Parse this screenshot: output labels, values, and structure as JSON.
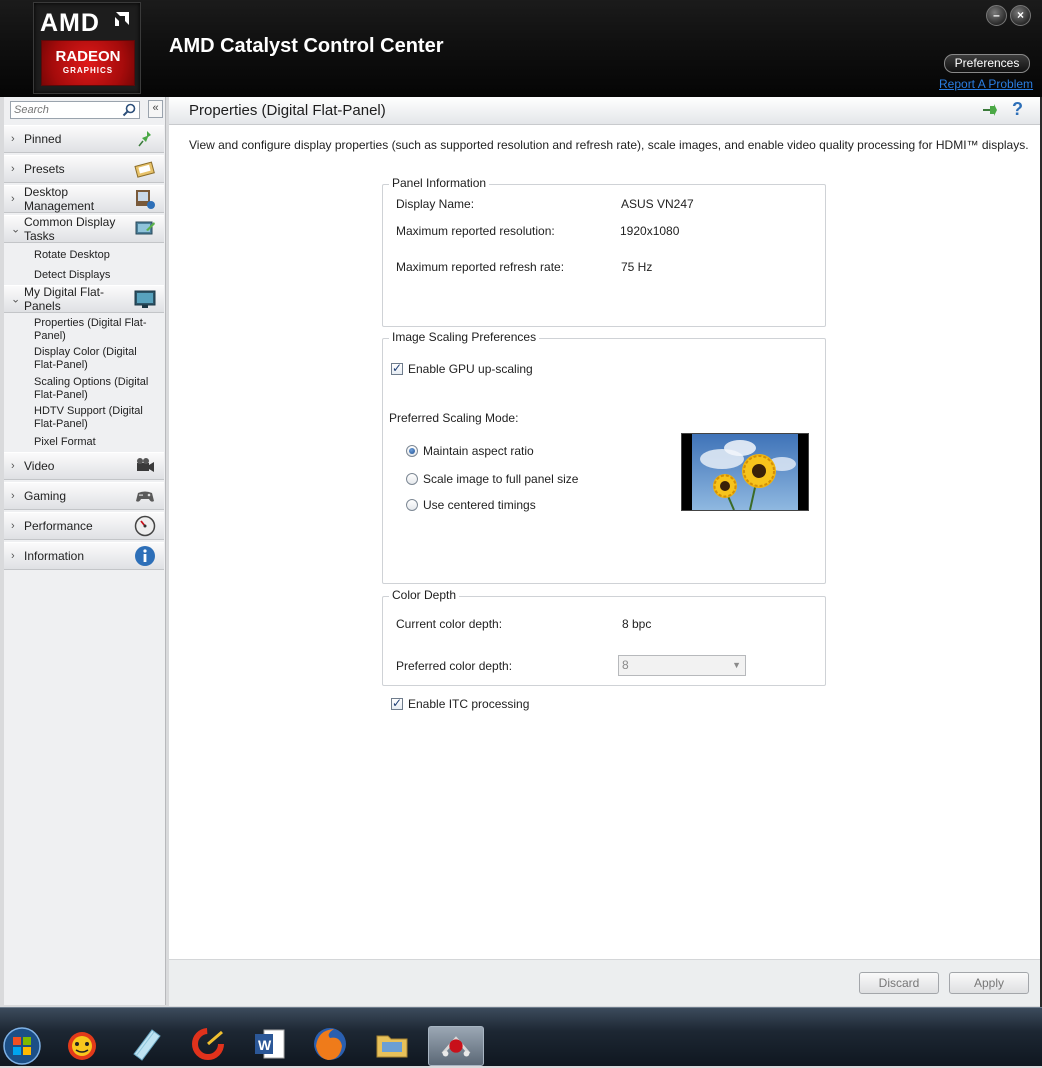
{
  "window": {
    "brand_amd": "AMD",
    "brand_radeon": "RADEON",
    "brand_graphics": "GRAPHICS",
    "title": "AMD Catalyst Control Center",
    "minimize_symbol": "–",
    "close_symbol": "×",
    "preferences_label": "Preferences",
    "report_problem_label": "Report A Problem"
  },
  "sidebar": {
    "search_placeholder": "Search",
    "collapse_symbol": "«",
    "sections": [
      {
        "label": "Pinned",
        "icon": "pin-icon",
        "expanded": false
      },
      {
        "label": "Presets",
        "icon": "presets-icon",
        "expanded": false
      },
      {
        "label": "Desktop Management",
        "icon": "desktop-management-icon",
        "expanded": false
      },
      {
        "label": "Common Display Tasks",
        "icon": "display-tasks-icon",
        "expanded": true,
        "items": [
          "Rotate Desktop",
          "Detect Displays"
        ]
      },
      {
        "label": "My Digital Flat-Panels",
        "icon": "flat-panel-icon",
        "expanded": true,
        "items": [
          "Properties (Digital Flat-Panel)",
          "Display Color (Digital Flat-Panel)",
          "Scaling Options (Digital Flat-Panel)",
          "HDTV Support (Digital Flat-Panel)",
          "Pixel Format"
        ]
      },
      {
        "label": "Video",
        "icon": "video-camera-icon",
        "expanded": false
      },
      {
        "label": "Gaming",
        "icon": "gamepad-icon",
        "expanded": false
      },
      {
        "label": "Performance",
        "icon": "gauge-icon",
        "expanded": false
      },
      {
        "label": "Information",
        "icon": "info-icon",
        "expanded": false
      }
    ]
  },
  "main": {
    "page_title": "Properties (Digital Flat-Panel)",
    "help_symbol": "?",
    "description": "View and configure display properties (such as supported resolution and refresh rate), scale images, and enable video quality processing for HDMI™ displays.",
    "panel_info": {
      "title": "Panel Information",
      "display_name_label": "Display Name:",
      "display_name_value": "ASUS VN247",
      "max_resolution_label": "Maximum reported resolution:",
      "max_resolution_value": "1920x1080",
      "max_refresh_label": "Maximum reported refresh rate:",
      "max_refresh_value": "75 Hz"
    },
    "scaling": {
      "title": "Image Scaling Preferences",
      "gpu_upscaling_label": "Enable GPU up-scaling",
      "gpu_upscaling_checked": true,
      "mode_label": "Preferred Scaling Mode:",
      "options": [
        "Maintain aspect ratio",
        "Scale image to full panel size",
        "Use centered timings"
      ],
      "selected_option": "Maintain aspect ratio"
    },
    "color_depth": {
      "title": "Color Depth",
      "current_label": "Current color depth:",
      "current_value": "8 bpc",
      "preferred_label": "Preferred color depth:",
      "preferred_value": "8",
      "dropdown_symbol": "▼"
    },
    "itc": {
      "label": "Enable ITC processing",
      "checked": true
    },
    "check_symbol": "✓",
    "footer": {
      "discard_label": "Discard",
      "apply_label": "Apply"
    }
  },
  "taskbar": {
    "apps": [
      "start-orb-icon",
      "paw-app-icon",
      "notepad-app-icon",
      "ccleaner-app-icon",
      "word-app-icon",
      "firefox-app-icon",
      "file-explorer-app-icon",
      "catalyst-app-icon"
    ],
    "active_app": "catalyst-app-icon"
  },
  "colors": {
    "accent_red": "#c8101a",
    "link_blue": "#2a7de1",
    "help_blue": "#2d6fb8"
  }
}
